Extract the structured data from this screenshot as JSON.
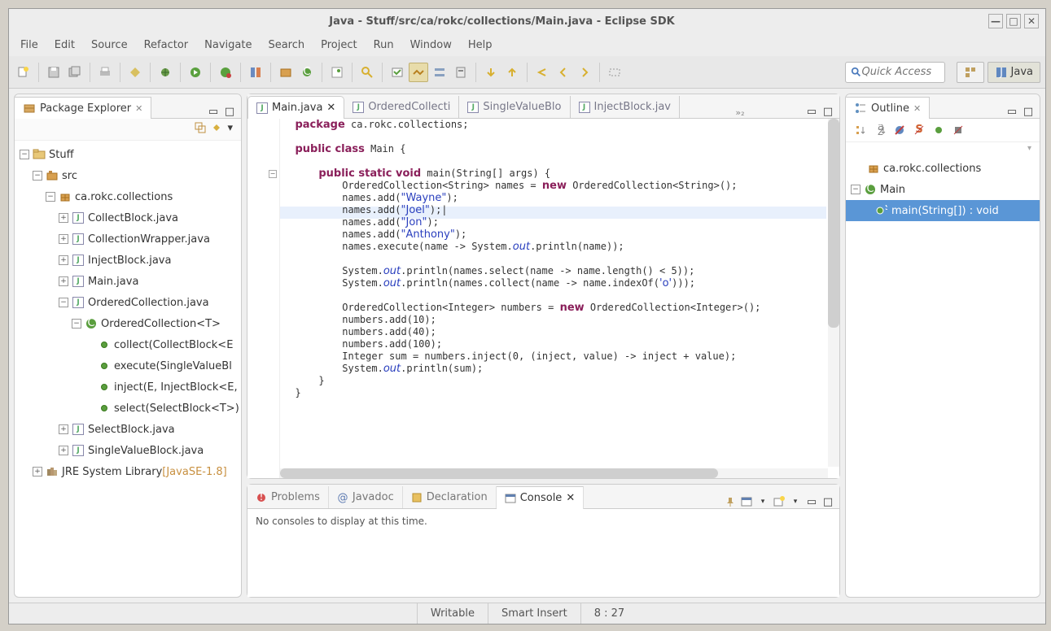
{
  "window": {
    "title": "Java - Stuff/src/ca/rokc/collections/Main.java - Eclipse SDK"
  },
  "menu": [
    "File",
    "Edit",
    "Source",
    "Refactor",
    "Navigate",
    "Search",
    "Project",
    "Run",
    "Window",
    "Help"
  ],
  "quick_access_placeholder": "Quick Access",
  "perspective_label": "Java",
  "package_explorer": {
    "title": "Package Explorer",
    "project": "Stuff",
    "src": "src",
    "pkg": "ca.rokc.collections",
    "files": {
      "collectblock": "CollectBlock.java",
      "collectionwrapper": "CollectionWrapper.java",
      "injectblock": "InjectBlock.java",
      "main": "Main.java",
      "orderedcollection": "OrderedCollection.java",
      "selectblock": "SelectBlock.java",
      "singlevalueblock": "SingleValueBlock.java"
    },
    "class_orderedcollection": "OrderedCollection<T>",
    "methods": {
      "collect": "collect(CollectBlock<E",
      "execute": "execute(SingleValueBl",
      "inject": "inject(E, InjectBlock<E,",
      "select": "select(SelectBlock<T>)"
    },
    "jre": "JRE System Library",
    "jre_decor": "[JavaSE-1.8]"
  },
  "editor": {
    "tabs": [
      "Main.java",
      "OrderedCollecti",
      "SingleValueBlo",
      "InjectBlock.jav"
    ],
    "overflow": "»₂"
  },
  "bottom": {
    "tabs": [
      "Problems",
      "Javadoc",
      "Declaration",
      "Console"
    ],
    "console_msg": "No consoles to display at this time."
  },
  "outline": {
    "title": "Outline",
    "pkg": "ca.rokc.collections",
    "class": "Main",
    "method": "main(String[]) : void"
  },
  "status": {
    "writable": "Writable",
    "insert": "Smart Insert",
    "pos": "8 : 27"
  }
}
